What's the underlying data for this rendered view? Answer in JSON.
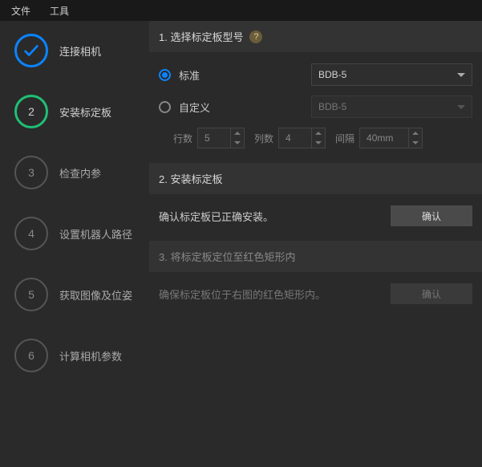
{
  "menu": {
    "file": "文件",
    "tools": "工具"
  },
  "steps": [
    {
      "num": "✓",
      "label": "连接相机",
      "state": "done"
    },
    {
      "num": "2",
      "label": "安装标定板",
      "state": "current"
    },
    {
      "num": "3",
      "label": "检查内参",
      "state": "pending"
    },
    {
      "num": "4",
      "label": "设置机器人路径",
      "state": "pending"
    },
    {
      "num": "5",
      "label": "获取图像及位姿",
      "state": "pending"
    },
    {
      "num": "6",
      "label": "计算相机参数",
      "state": "pending"
    }
  ],
  "section1": {
    "title": "1. 选择标定板型号",
    "help": "?",
    "radio_standard": "标准",
    "radio_custom": "自定义",
    "select_standard": "BDB-5",
    "select_custom": "BDB-5",
    "rows_label": "行数",
    "rows_value": "5",
    "cols_label": "列数",
    "cols_value": "4",
    "spacing_label": "间隔",
    "spacing_value": "40mm"
  },
  "section2": {
    "title": "2. 安装标定板",
    "text": "确认标定板已正确安装。",
    "confirm": "确认"
  },
  "section3": {
    "title": "3. 将标定板定位至红色矩形内",
    "text": "确保标定板位于右图的红色矩形内。",
    "confirm": "确认"
  }
}
